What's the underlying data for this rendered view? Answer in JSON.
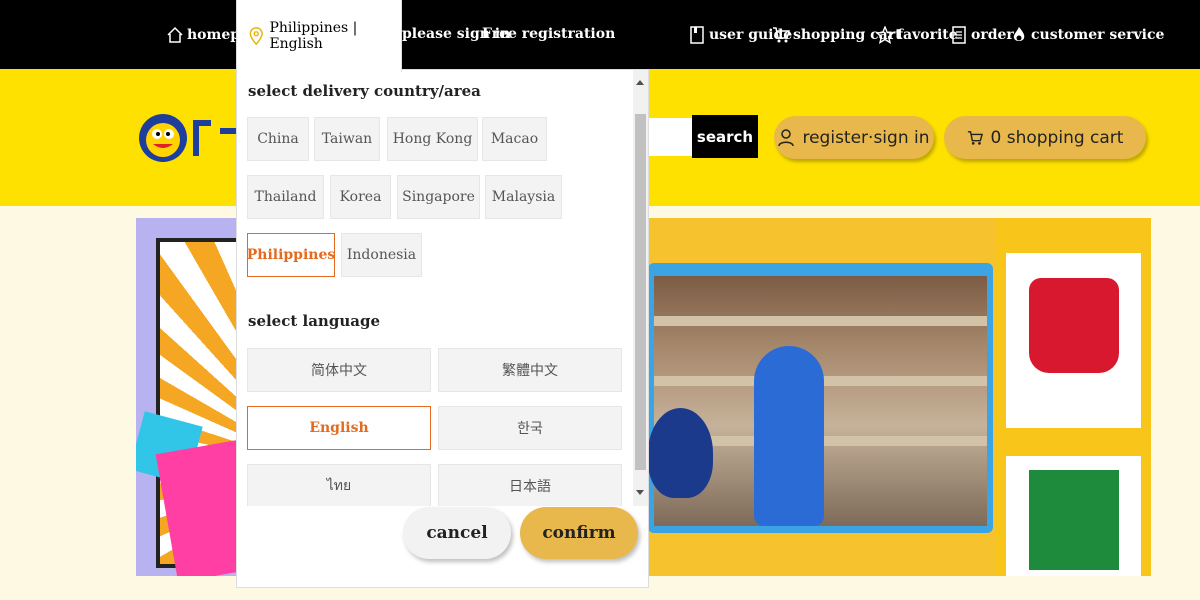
{
  "topbar": {
    "homepage": "homepage",
    "location": "Philippines | English",
    "sign_in": "please sign in",
    "register": "Free registration",
    "user_guide": "user guide",
    "shopping_cart": "shopping cart",
    "favorite": "favorite",
    "order": "order",
    "customer_service": "customer service"
  },
  "header": {
    "search_label": "search",
    "register_signin": "register·sign in",
    "cart": "0 shopping cart"
  },
  "dropdown": {
    "country_title": "select delivery country/area",
    "countries": [
      {
        "label": "China",
        "selected": false
      },
      {
        "label": "Taiwan",
        "selected": false
      },
      {
        "label": "Hong Kong",
        "selected": false
      },
      {
        "label": "Macao",
        "selected": false
      },
      {
        "label": "Thailand",
        "selected": false
      },
      {
        "label": "Korea",
        "selected": false
      },
      {
        "label": "Singapore",
        "selected": false
      },
      {
        "label": "Malaysia",
        "selected": false
      },
      {
        "label": "Philippines",
        "selected": true
      },
      {
        "label": "Indonesia",
        "selected": false
      }
    ],
    "language_title": "select language",
    "languages": [
      {
        "label": "简体中文",
        "selected": false
      },
      {
        "label": "繁體中文",
        "selected": false
      },
      {
        "label": "English",
        "selected": true
      },
      {
        "label": "한국",
        "selected": false
      },
      {
        "label": "ไทย",
        "selected": false
      },
      {
        "label": "日本語",
        "selected": false
      }
    ],
    "cancel": "cancel",
    "confirm": "confirm"
  },
  "colors": {
    "topbar": "#000000",
    "header": "#ffe100",
    "accent": "#e56a1f",
    "button": "#e8b84c"
  }
}
